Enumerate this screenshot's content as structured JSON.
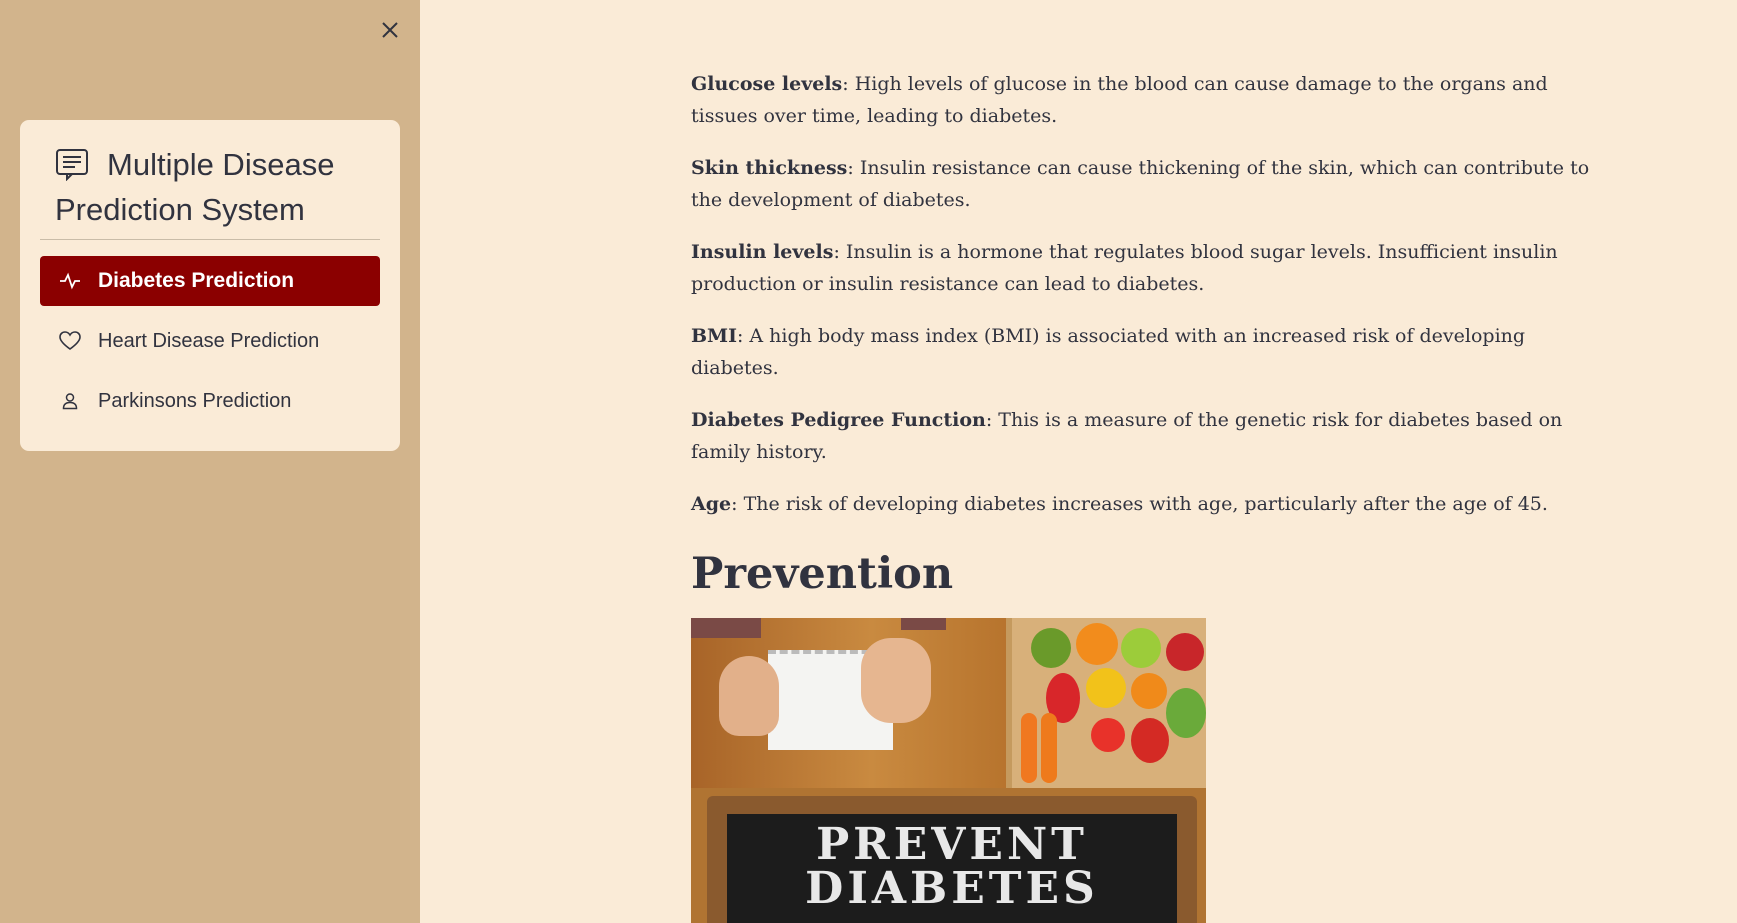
{
  "sidebar": {
    "close_icon": "close-icon",
    "menu": {
      "title": "Multiple Disease Prediction System",
      "title_icon": "document-list-icon",
      "items": [
        {
          "label": "Diabetes Prediction",
          "icon": "activity-pulse-icon",
          "active": true
        },
        {
          "label": "Heart Disease Prediction",
          "icon": "heart-icon",
          "active": false
        },
        {
          "label": "Parkinsons Prediction",
          "icon": "person-icon",
          "active": false
        }
      ],
      "active_color": "#8b0000"
    },
    "background_color": "#d2b48c"
  },
  "main": {
    "background_color": "#faebd7",
    "factors": [
      {
        "term": "Glucose levels",
        "text": ": High levels of glucose in the blood can cause damage to the organs and tissues over time, leading to diabetes."
      },
      {
        "term": "Skin thickness",
        "text": ": Insulin resistance can cause thickening of the skin, which can contribute to the development of diabetes."
      },
      {
        "term": "Insulin levels",
        "text": ": Insulin is a hormone that regulates blood sugar levels. Insufficient insulin production or insulin resistance can lead to diabetes."
      },
      {
        "term": "BMI",
        "text": ": A high body mass index (BMI) is associated with an increased risk of developing diabetes."
      },
      {
        "term": "Diabetes Pedigree Function",
        "text": ": This is a measure of the genetic risk for diabetes based on family history."
      },
      {
        "term": "Age",
        "text": ": The risk of developing diabetes increases with age, particularly after the age of 45."
      }
    ],
    "prevention_heading": "Prevention",
    "prevention_image": {
      "chalk_line1": "PREVENT",
      "chalk_line2": "DIABETES"
    }
  }
}
